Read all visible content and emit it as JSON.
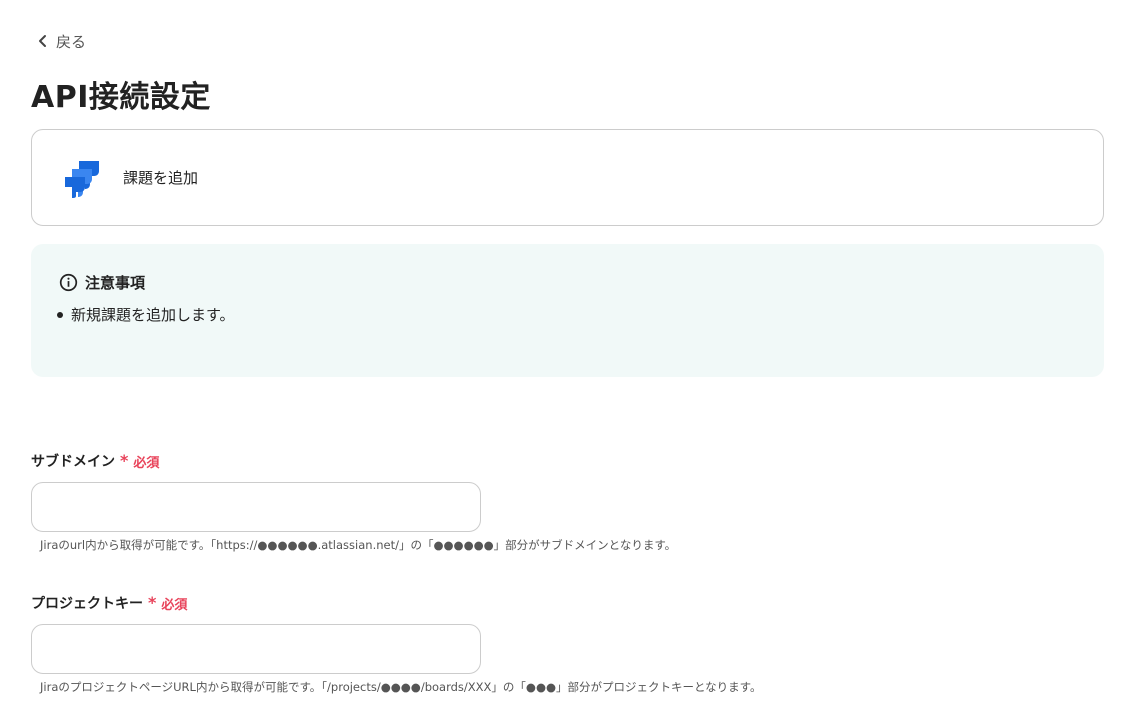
{
  "header": {
    "back_label": "戻る",
    "title": "API接続設定"
  },
  "app_card": {
    "icon": "jira-logo-icon",
    "label": "課題を追加"
  },
  "notice": {
    "icon": "info-circle-icon",
    "heading": "注意事項",
    "items": [
      "新規課題を追加します。"
    ]
  },
  "fields": [
    {
      "label": "サブドメイン",
      "required_mark": "*",
      "required_text": "必須",
      "value": "",
      "placeholder": "",
      "help": "Jiraのurl内から取得が可能です。「https://●●●●●●.atlassian.net/」の「●●●●●●」部分がサブドメインとなります。"
    },
    {
      "label": "プロジェクトキー",
      "required_mark": "*",
      "required_text": "必須",
      "value": "",
      "placeholder": "",
      "help": "JiraのプロジェクトページURL内から取得が可能です。「/projects/●●●●/boards/XXX」の「●●●」部分がプロジェクトキーとなります。"
    }
  ],
  "colors": {
    "accent_required": "#e8435a",
    "notice_bg": "#f1f9f8",
    "jira_blue": "#1868db"
  }
}
